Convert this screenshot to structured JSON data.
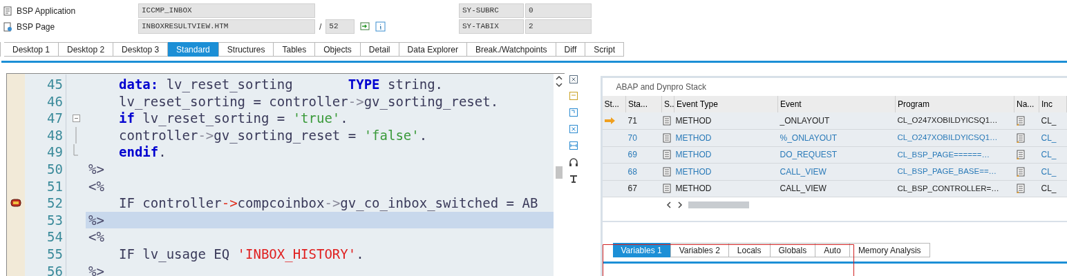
{
  "header": {
    "fields": [
      {
        "label": "BSP Application",
        "value": "ICCMP_INBOX",
        "kind": "app"
      },
      {
        "label": "BSP Page",
        "value": "INBOXRESULTVIEW.HTM",
        "kind": "page",
        "separator": "/",
        "line": "52"
      }
    ],
    "sys_fields": [
      {
        "label": "SY-SUBRC",
        "value": "0"
      },
      {
        "label": "SY-TABIX",
        "value": "2"
      }
    ]
  },
  "tabs": [
    {
      "label": "Desktop 1",
      "selected": false
    },
    {
      "label": "Desktop 2",
      "selected": false
    },
    {
      "label": "Desktop 3",
      "selected": false
    },
    {
      "label": "Standard",
      "selected": true
    },
    {
      "label": "Structures",
      "selected": false
    },
    {
      "label": "Tables",
      "selected": false
    },
    {
      "label": "Objects",
      "selected": false
    },
    {
      "label": "Detail",
      "selected": false
    },
    {
      "label": "Data Explorer",
      "selected": false
    },
    {
      "label": "Break./Watchpoints",
      "selected": false
    },
    {
      "label": "Diff",
      "selected": false
    },
    {
      "label": "Script",
      "selected": false
    }
  ],
  "editor": {
    "lines": [
      {
        "number": "45",
        "kind": "code",
        "tokens": [
          {
            "kind": "keyword",
            "text": "data:"
          },
          {
            "kind": "plain",
            "text": " lv_reset_sorting       "
          },
          {
            "kind": "keyword",
            "text": "TYPE"
          },
          {
            "kind": "plain",
            "text": " string."
          }
        ]
      },
      {
        "number": "46",
        "kind": "code",
        "tokens": [
          {
            "kind": "plain",
            "text": "lv_reset_sorting = controller"
          },
          {
            "kind": "operator",
            "text": "->"
          },
          {
            "kind": "plain",
            "text": "gv_sorting_reset."
          }
        ]
      },
      {
        "number": "47",
        "kind": "code",
        "tokens": [
          {
            "kind": "keyword",
            "text": "if"
          },
          {
            "kind": "plain",
            "text": " lv_reset_sorting = "
          },
          {
            "kind": "string",
            "text": "'true'"
          },
          {
            "kind": "plain",
            "text": "."
          }
        ],
        "children": [
          {
            "number": "48",
            "kind": "code",
            "tokens": [
              {
                "kind": "plain",
                "text": "controller"
              },
              {
                "kind": "operator",
                "text": "->"
              },
              {
                "kind": "plain",
                "text": "gv_sorting_reset = "
              },
              {
                "kind": "string",
                "text": "'false'"
              },
              {
                "kind": "plain",
                "text": "."
              }
            ]
          },
          {
            "number": "49",
            "kind": "code",
            "tokens": [
              {
                "kind": "keyword",
                "text": "endif"
              },
              {
                "kind": "plain",
                "text": "."
              }
            ]
          }
        ]
      },
      {
        "number": "50",
        "kind": "tag",
        "tokens": [
          {
            "kind": "tag",
            "text": "%>"
          }
        ]
      },
      {
        "number": "51",
        "kind": "tag",
        "tokens": [
          {
            "kind": "tag",
            "text": "<%"
          }
        ]
      },
      {
        "number": "52",
        "kind": "code",
        "breakpoint": true,
        "tokens": [
          {
            "kind": "plain",
            "text": "IF controller"
          },
          {
            "kind": "operator-red",
            "text": "->"
          },
          {
            "kind": "plain",
            "text": "compcoinbox"
          },
          {
            "kind": "operator",
            "text": "->"
          },
          {
            "kind": "plain",
            "text": "gv_co_inbox_switched = AB"
          }
        ]
      },
      {
        "number": "53",
        "kind": "tag",
        "current": true,
        "tokens": [
          {
            "kind": "tag",
            "text": "%>"
          }
        ]
      },
      {
        "number": "54",
        "kind": "tag",
        "tokens": [
          {
            "kind": "tag",
            "text": "<%"
          }
        ]
      },
      {
        "number": "55",
        "kind": "code",
        "tokens": [
          {
            "kind": "plain",
            "text": "IF lv_usage EQ "
          },
          {
            "kind": "literal",
            "text": "'INBOX_HISTORY'"
          },
          {
            "kind": "plain",
            "text": "."
          }
        ]
      },
      {
        "number": "56",
        "kind": "tag",
        "tokens": [
          {
            "kind": "tag",
            "text": "%>"
          }
        ]
      }
    ]
  },
  "stack": {
    "title": "ABAP and Dynpro Stack",
    "columns": [
      "St...",
      "Sta...",
      "S..",
      "Event Type",
      "Event",
      "Program",
      "Na...",
      "Inc"
    ],
    "rows": [
      {
        "current": true,
        "highlighted": false,
        "level": "71",
        "event_type": "METHOD",
        "event": "_ONLAYOUT",
        "program": "CL_O247XOBILDYICSQ1…",
        "include": "CL_"
      },
      {
        "current": false,
        "highlighted": true,
        "level": "70",
        "event_type": "METHOD",
        "event": "%_ONLAYOUT",
        "program": "CL_O247XOBILDYICSQ1…",
        "include": "CL_"
      },
      {
        "current": false,
        "highlighted": true,
        "level": "69",
        "event_type": "METHOD",
        "event": "DO_REQUEST",
        "program": "CL_BSP_PAGE======…",
        "include": "CL_"
      },
      {
        "current": false,
        "highlighted": true,
        "level": "68",
        "event_type": "METHOD",
        "event": "CALL_VIEW",
        "program": "CL_BSP_PAGE_BASE==…",
        "include": "CL_"
      },
      {
        "current": false,
        "highlighted": false,
        "level": "67",
        "event_type": "METHOD",
        "event": "CALL_VIEW",
        "program": "CL_BSP_CONTROLLER=…",
        "include": "CL_"
      }
    ]
  },
  "variables_tabs": [
    {
      "label": "Variables 1",
      "selected": true
    },
    {
      "label": "Variables 2",
      "selected": false
    },
    {
      "label": "Locals",
      "selected": false
    },
    {
      "label": "Globals",
      "selected": false
    },
    {
      "label": "Auto",
      "selected": false
    },
    {
      "label": "Memory Analysis",
      "selected": false
    }
  ]
}
